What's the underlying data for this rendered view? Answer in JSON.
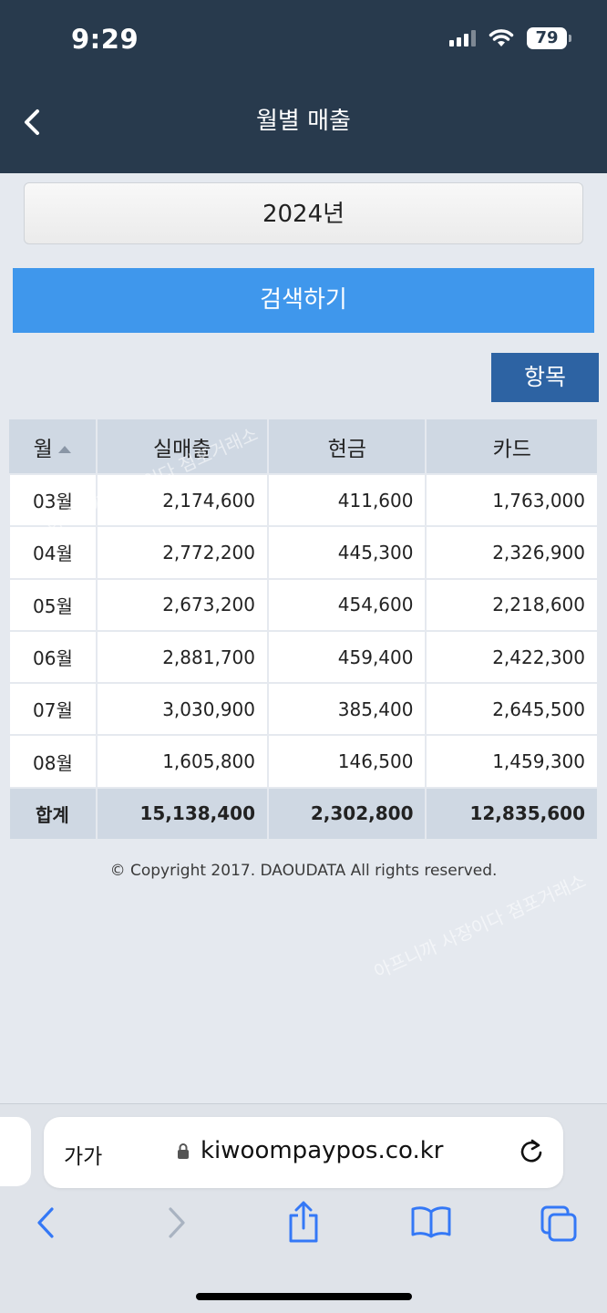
{
  "status": {
    "time": "9:29",
    "battery": "79"
  },
  "header": {
    "title": "월별 매출"
  },
  "filter": {
    "year": "2024년",
    "search_label": "검색하기",
    "items_label": "항목"
  },
  "table": {
    "columns": [
      "월",
      "실매출",
      "현금",
      "카드"
    ],
    "rows": [
      {
        "month": "03월",
        "sales": "2,174,600",
        "cash": "411,600",
        "card": "1,763,000"
      },
      {
        "month": "04월",
        "sales": "2,772,200",
        "cash": "445,300",
        "card": "2,326,900"
      },
      {
        "month": "05월",
        "sales": "2,673,200",
        "cash": "454,600",
        "card": "2,218,600"
      },
      {
        "month": "06월",
        "sales": "2,881,700",
        "cash": "459,400",
        "card": "2,422,300"
      },
      {
        "month": "07월",
        "sales": "3,030,900",
        "cash": "385,400",
        "card": "2,645,500"
      },
      {
        "month": "08월",
        "sales": "1,605,800",
        "cash": "146,500",
        "card": "1,459,300"
      }
    ],
    "total": {
      "label": "합계",
      "sales": "15,138,400",
      "cash": "2,302,800",
      "card": "12,835,600"
    }
  },
  "footer": {
    "copyright": "© Copyright 2017. DAOUDATA All rights reserved."
  },
  "watermark": {
    "text": "아프니까 사장이다 점포거래소"
  },
  "browser": {
    "text_size_label": "가가",
    "url": "kiwoompaypos.co.kr"
  },
  "colors": {
    "header_bg": "#283a4d",
    "search_button": "#3f97ec",
    "items_button": "#2d63a3",
    "accent_icon": "#3478f6"
  }
}
